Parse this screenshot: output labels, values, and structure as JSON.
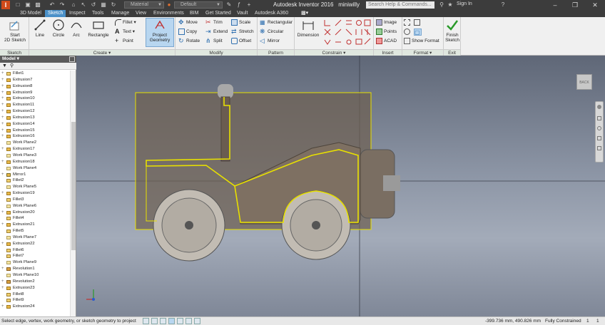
{
  "titlebar": {
    "material": "Material",
    "appearance": "Default",
    "app_title": "Autodesk Inventor 2016",
    "doc_name": "miniwilly",
    "search_placeholder": "Search Help & Commands...",
    "sign_in": "Sign In"
  },
  "tabs": [
    "3D Model",
    "Sketch",
    "Inspect",
    "Tools",
    "Manage",
    "View",
    "Environments",
    "BIM",
    "Get Started",
    "Vault",
    "Autodesk A360"
  ],
  "active_tab": "Sketch",
  "ribbon": {
    "sketch_panel": {
      "start_sketch": "Start",
      "start_sketch2": "2D Sketch",
      "label": "Sketch"
    },
    "create_panel": {
      "line": "Line",
      "circle": "Circle",
      "arc": "Arc",
      "rectangle": "Rectangle",
      "fillet": "Fillet",
      "text": "Text",
      "point": "Point",
      "project_geometry": "Project",
      "project_geometry2": "Geometry",
      "label": "Create"
    },
    "modify_panel": {
      "move": "Move",
      "copy": "Copy",
      "rotate": "Rotate",
      "trim": "Trim",
      "extend": "Extend",
      "split": "Split",
      "scale": "Scale",
      "stretch": "Stretch",
      "offset": "Offset",
      "label": "Modify"
    },
    "pattern_panel": {
      "rectangular": "Rectangular",
      "circular": "Circular",
      "mirror": "Mirror",
      "label": "Pattern"
    },
    "constrain_panel": {
      "dimension": "Dimension",
      "label": "Constrain"
    },
    "insert_panel": {
      "image": "Image",
      "points": "Points",
      "acad": "ACAD",
      "label": "Insert"
    },
    "format_panel": {
      "show_format": "Show Format",
      "label": "Format"
    },
    "exit_panel": {
      "finish_sketch": "Finish",
      "finish_sketch2": "Sketch",
      "label": "Exit"
    }
  },
  "browser": {
    "header": "Model",
    "items": [
      {
        "label": "Fillet1",
        "type": "fillet",
        "exp": "+"
      },
      {
        "label": "Extrusion7",
        "type": "extrusion",
        "exp": "+"
      },
      {
        "label": "Extrusion8",
        "type": "extrusion",
        "exp": "+"
      },
      {
        "label": "Extrusion9",
        "type": "extrusion",
        "exp": "+"
      },
      {
        "label": "Extrusion10",
        "type": "extrusion",
        "exp": "+"
      },
      {
        "label": "Extrusion11",
        "type": "extrusion",
        "exp": "+"
      },
      {
        "label": "Extrusion12",
        "type": "extrusion",
        "exp": "+"
      },
      {
        "label": "Extrusion13",
        "type": "extrusion",
        "exp": "+"
      },
      {
        "label": "Extrusion14",
        "type": "extrusion",
        "exp": "+"
      },
      {
        "label": "Extrusion15",
        "type": "extrusion",
        "exp": "+"
      },
      {
        "label": "Extrusion16",
        "type": "extrusion",
        "exp": "+"
      },
      {
        "label": "Work Plane2",
        "type": "plane",
        "exp": ""
      },
      {
        "label": "Extrusion17",
        "type": "extrusion",
        "exp": "+"
      },
      {
        "label": "Work Plane3",
        "type": "plane",
        "exp": ""
      },
      {
        "label": "Extrusion18",
        "type": "extrusion",
        "exp": "+"
      },
      {
        "label": "Work Plane4",
        "type": "plane",
        "exp": ""
      },
      {
        "label": "Mirror1",
        "type": "mirror",
        "exp": "+"
      },
      {
        "label": "Fillet2",
        "type": "fillet",
        "exp": ""
      },
      {
        "label": "Work Plane5",
        "type": "plane",
        "exp": ""
      },
      {
        "label": "Extrusion19",
        "type": "extrusion",
        "exp": "+"
      },
      {
        "label": "Fillet3",
        "type": "fillet",
        "exp": ""
      },
      {
        "label": "Work Plane6",
        "type": "plane",
        "exp": ""
      },
      {
        "label": "Extrusion20",
        "type": "extrusion",
        "exp": "+"
      },
      {
        "label": "Fillet4",
        "type": "fillet",
        "exp": ""
      },
      {
        "label": "Extrusion21",
        "type": "extrusion",
        "exp": "+"
      },
      {
        "label": "Fillet5",
        "type": "fillet",
        "exp": ""
      },
      {
        "label": "Work Plane7",
        "type": "plane",
        "exp": ""
      },
      {
        "label": "Extrusion22",
        "type": "extrusion",
        "exp": "+"
      },
      {
        "label": "Fillet6",
        "type": "fillet",
        "exp": ""
      },
      {
        "label": "Fillet7",
        "type": "fillet",
        "exp": ""
      },
      {
        "label": "Work Plane9",
        "type": "plane",
        "exp": ""
      },
      {
        "label": "Revolution1",
        "type": "revolution",
        "exp": "+"
      },
      {
        "label": "Work Plane10",
        "type": "plane",
        "exp": ""
      },
      {
        "label": "Revolution2",
        "type": "revolution",
        "exp": "+"
      },
      {
        "label": "Extrusion23",
        "type": "extrusion",
        "exp": "+"
      },
      {
        "label": "Fillet8",
        "type": "fillet",
        "exp": ""
      },
      {
        "label": "Fillet9",
        "type": "fillet",
        "exp": ""
      },
      {
        "label": "Extrusion24",
        "type": "extrusion",
        "exp": "+"
      }
    ]
  },
  "viewcube_label": "BACK",
  "status": {
    "message": "Select edge, vertex, work geometry, or sketch geometry to project",
    "coords": "-399.736 mm, 490.826 mm",
    "constraint": "Fully Constrained",
    "n1": "1",
    "n2": "1"
  },
  "colors": {
    "accent": "#4a90c8",
    "sketch_yellow": "#e8e000",
    "body_brown": "#6e5f52",
    "title_bg": "#3c3c3c"
  }
}
